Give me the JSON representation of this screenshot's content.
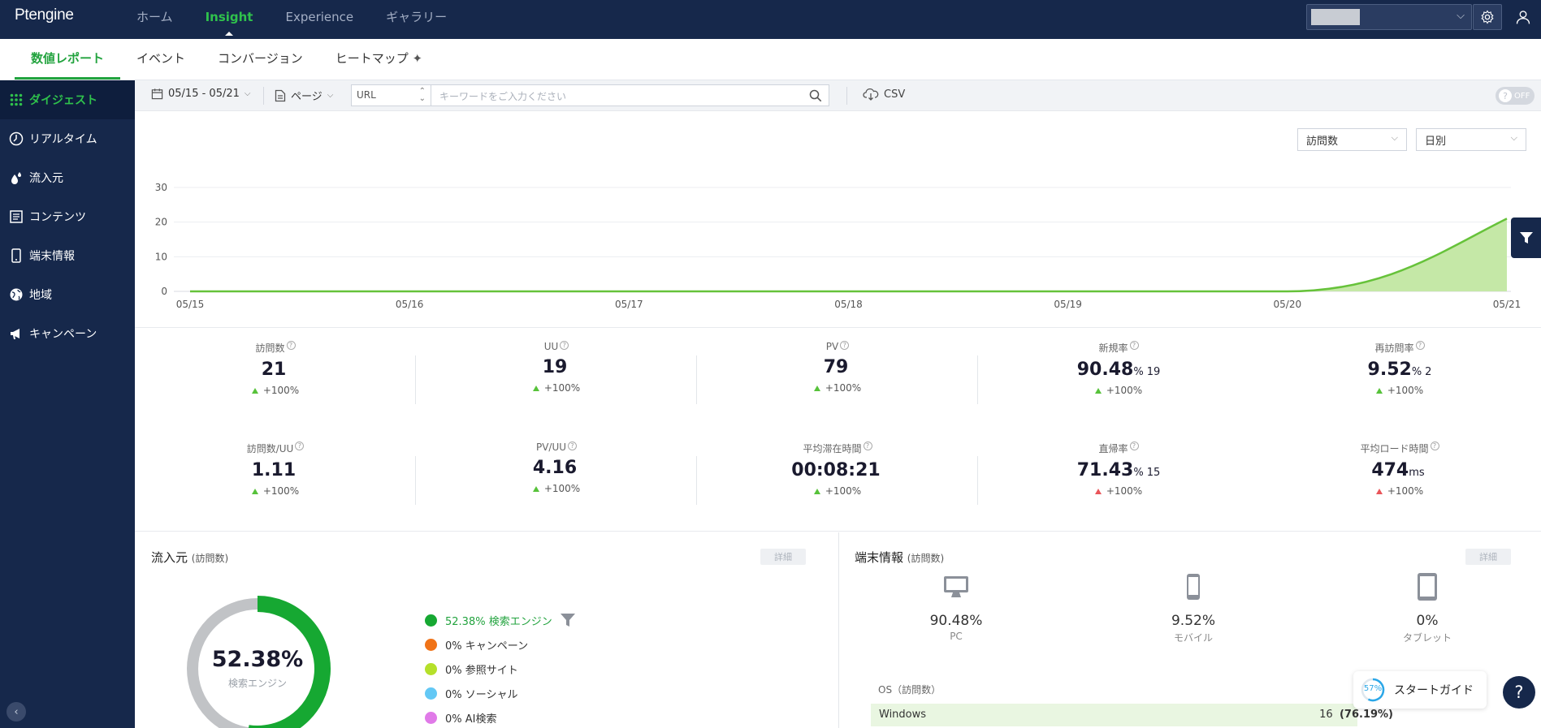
{
  "header": {
    "logo": "Ptengine",
    "nav": [
      "ホーム",
      "Insight",
      "Experience",
      "ギャラリー"
    ],
    "active_nav": "Insight"
  },
  "subnav": {
    "tabs": [
      "数値レポート",
      "イベント",
      "コンバージョン",
      "ヒートマップ"
    ],
    "active": "数値レポート"
  },
  "sidebar": {
    "items": [
      {
        "label": "ダイジェスト",
        "icon": "grid-icon"
      },
      {
        "label": "リアルタイム",
        "icon": "clock-icon"
      },
      {
        "label": "流入元",
        "icon": "drops-icon"
      },
      {
        "label": "コンテンツ",
        "icon": "document-icon"
      },
      {
        "label": "端末情報",
        "icon": "phone-icon"
      },
      {
        "label": "地域",
        "icon": "globe-icon"
      },
      {
        "label": "キャンペーン",
        "icon": "megaphone-icon"
      }
    ],
    "active": "ダイジェスト"
  },
  "toolbar": {
    "date_range": "05/15 - 05/21",
    "page_label": "ページ",
    "url_select": "URL",
    "keyword_placeholder": "キーワードをご入力ください",
    "csv_label": "CSV",
    "toggle_label": "OFF"
  },
  "chart_controls": {
    "metric_select": "訪問数",
    "interval_select": "日別"
  },
  "chart_data": {
    "type": "area",
    "categories": [
      "05/15",
      "05/16",
      "05/17",
      "05/18",
      "05/19",
      "05/20",
      "05/21"
    ],
    "values": [
      0,
      0,
      0,
      0,
      0,
      0,
      21
    ],
    "yticks": [
      0,
      10,
      20,
      30
    ],
    "ylim": [
      0,
      30
    ],
    "title": "",
    "xlabel": "",
    "ylabel": "",
    "color": "#66c23a",
    "fill": "#c5e8a7"
  },
  "metrics": [
    {
      "label": "訪問数",
      "value": "21",
      "unit": "",
      "extra": "",
      "change": "+100%",
      "trend": "up-green"
    },
    {
      "label": "UU",
      "value": "19",
      "unit": "",
      "extra": "",
      "change": "+100%",
      "trend": "up-green"
    },
    {
      "label": "PV",
      "value": "79",
      "unit": "",
      "extra": "",
      "change": "+100%",
      "trend": "up-green"
    },
    {
      "label": "新規率",
      "value": "90.48",
      "unit": "%",
      "extra": "19",
      "change": "+100%",
      "trend": "up-green"
    },
    {
      "label": "再訪問率",
      "value": "9.52",
      "unit": "%",
      "extra": "2",
      "change": "+100%",
      "trend": "up-green"
    },
    {
      "label": "訪問数/UU",
      "value": "1.11",
      "unit": "",
      "extra": "",
      "change": "+100%",
      "trend": "up-green"
    },
    {
      "label": "PV/UU",
      "value": "4.16",
      "unit": "",
      "extra": "",
      "change": "+100%",
      "trend": "up-green"
    },
    {
      "label": "平均滞在時間",
      "value": "00:08:21",
      "unit": "",
      "extra": "",
      "change": "+100%",
      "trend": "up-green"
    },
    {
      "label": "直帰率",
      "value": "71.43",
      "unit": "%",
      "extra": "15",
      "change": "+100%",
      "trend": "up-red"
    },
    {
      "label": "平均ロード時間",
      "value": "474",
      "unit": "ms",
      "extra": "",
      "change": "+100%",
      "trend": "up-red"
    }
  ],
  "sources_panel": {
    "title": "流入元",
    "subtitle": "(訪問数)",
    "detail": "詳細",
    "donut_pct": "52.38%",
    "donut_label": "検索エンジン",
    "donut_fraction": 0.5238,
    "legend": [
      {
        "text": "52.38% 検索エンジン",
        "color": "#16a832"
      },
      {
        "text": "0% キャンペーン",
        "color": "#f07318"
      },
      {
        "text": "0% 参照サイト",
        "color": "#b5e02a"
      },
      {
        "text": "0% ソーシャル",
        "color": "#63c8f5"
      },
      {
        "text": "0% AI検索",
        "color": "#e07ae8"
      }
    ]
  },
  "device_panel": {
    "title": "端末情報",
    "subtitle": "(訪問数)",
    "detail": "詳細",
    "devices": [
      {
        "pct": "90.48%",
        "name": "PC",
        "icon": "monitor-icon"
      },
      {
        "pct": "9.52%",
        "name": "モバイル",
        "icon": "mobile-icon"
      },
      {
        "pct": "0%",
        "name": "タブレット",
        "icon": "tablet-icon"
      }
    ],
    "os_title": "OS（訪問数）",
    "os_rows": [
      {
        "name": "Windows",
        "count": "16",
        "pct": "(76.19%)",
        "fraction": 0.7619
      }
    ]
  },
  "guide": {
    "percent": "57%",
    "label": "スタートガイド",
    "fraction": 0.57
  },
  "help": "?"
}
